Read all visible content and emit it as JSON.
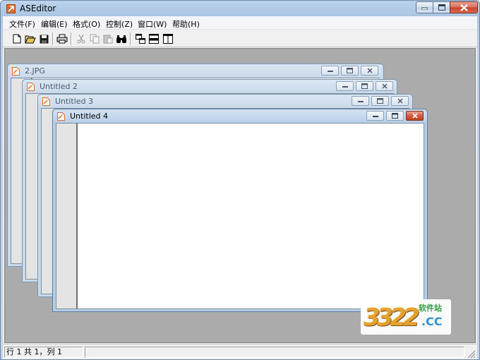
{
  "app": {
    "title": "ASEditor"
  },
  "menu": [
    "文件(F)",
    "编辑(E)",
    "格式(O)",
    "控制(Z)",
    "窗口(W)",
    "帮助(H)"
  ],
  "toolbar": [
    "new-icon",
    "open-icon",
    "save-icon",
    "print-icon",
    "cut-icon",
    "copy-icon",
    "paste-icon",
    "find-icon",
    "cascade-icon",
    "tile-horizontal-icon",
    "tile-vertical-icon"
  ],
  "documents": [
    {
      "title": "2.JPG"
    },
    {
      "title": "Untitled 2"
    },
    {
      "title": "Untitled 3"
    },
    {
      "title": "Untitled 4"
    }
  ],
  "status": {
    "position": "行 1 共 1，列 1"
  },
  "watermark": {
    "digits": "3322",
    "suffix": ".CC",
    "chars": "软件站"
  }
}
